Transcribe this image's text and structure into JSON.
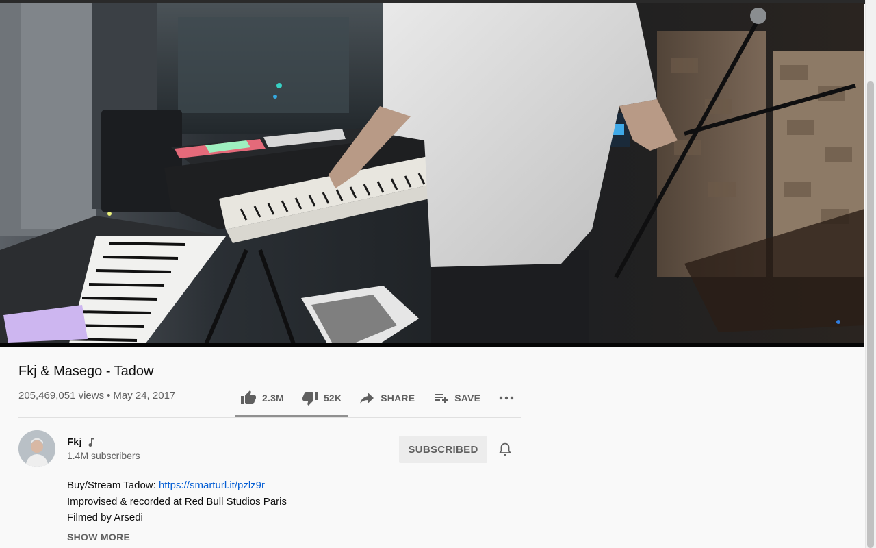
{
  "video": {
    "title": "Fkj & Masego - Tadow",
    "views": "205,469,051 views",
    "date": "May 24, 2017",
    "meta_separator": "•"
  },
  "actions": {
    "like": {
      "label": "2.3M",
      "icon": "thumb-up-icon"
    },
    "dislike": {
      "label": "52K",
      "icon": "thumb-down-icon"
    },
    "share": {
      "label": "SHARE",
      "icon": "share-icon"
    },
    "save": {
      "label": "SAVE",
      "icon": "playlist-add-icon"
    },
    "more": {
      "icon": "more-horizontal-icon"
    },
    "like_ratio": 1.0
  },
  "channel": {
    "name": "Fkj",
    "subscribers": "1.4M subscribers",
    "badge_icon": "music-note-icon",
    "subscribe_label": "SUBSCRIBED",
    "bell_icon": "bell-icon"
  },
  "description": {
    "line1_prefix": "Buy/Stream Tadow: ",
    "line1_link": "https://smarturl.it/pzlz9r",
    "line2": "Improvised & recorded at Red Bull Studios Paris",
    "line3": "Filmed by Arsedi",
    "show_more": "SHOW MORE"
  },
  "colors": {
    "link": "#065fd4",
    "secondary_text": "#606060",
    "subscribed_bg": "#ececec"
  }
}
